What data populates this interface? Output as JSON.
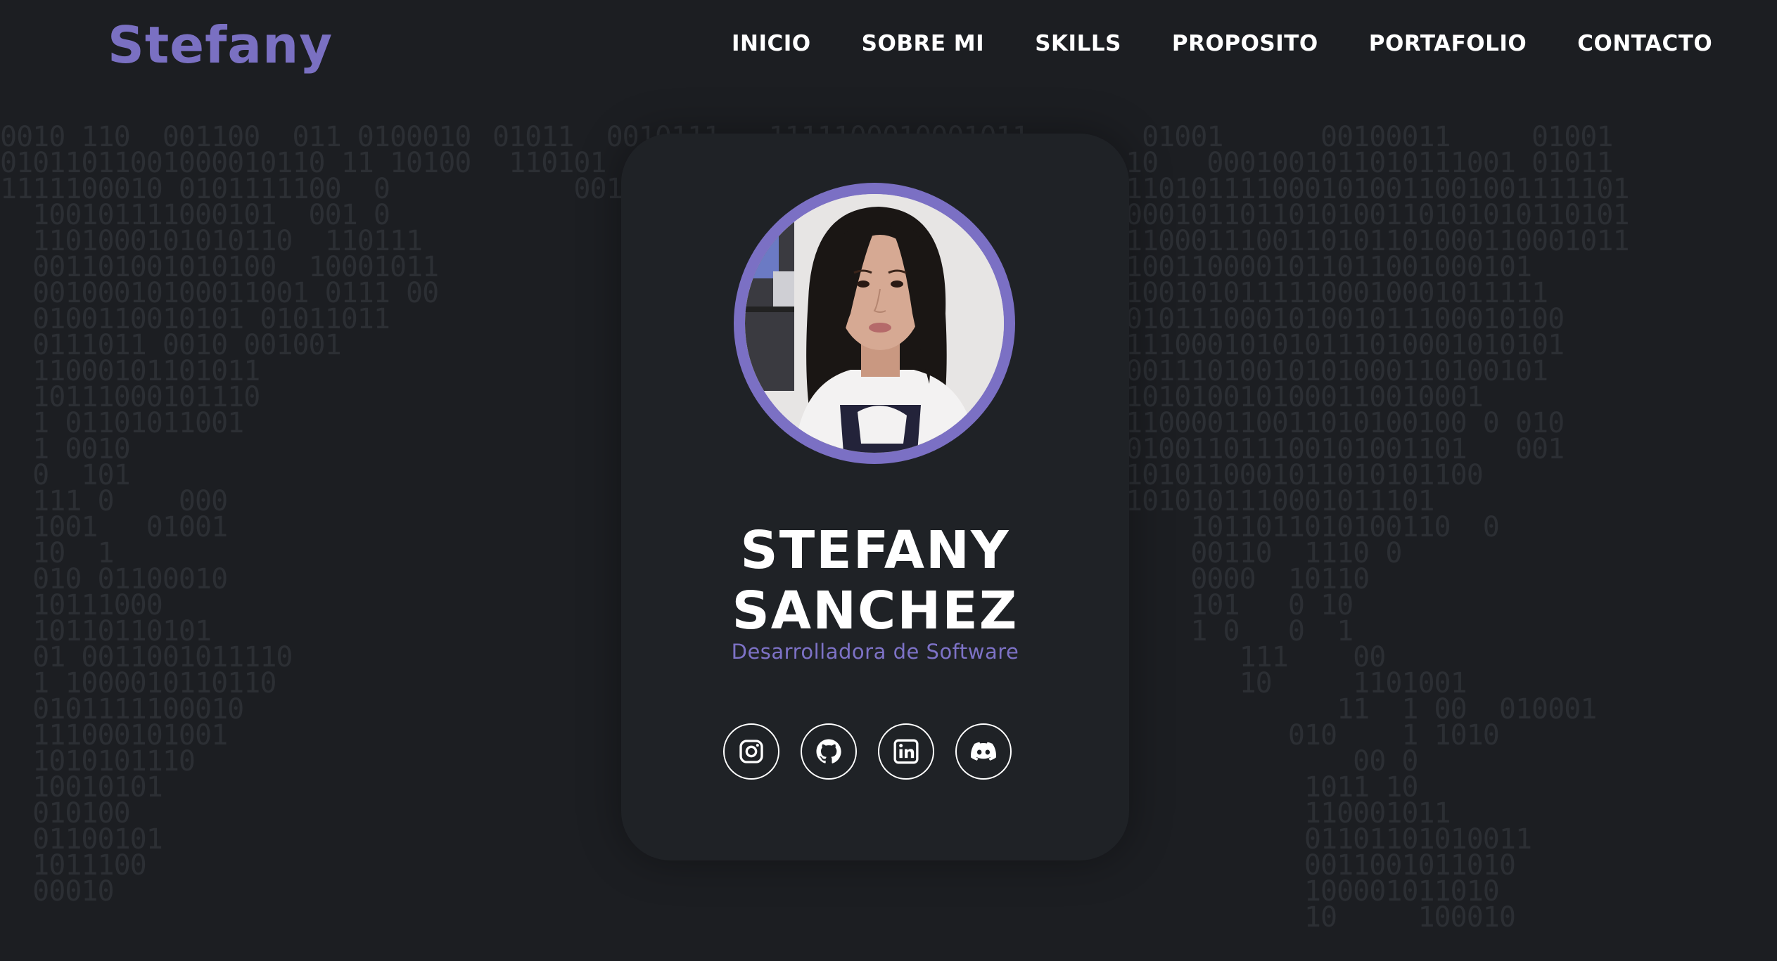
{
  "header": {
    "logo": "Stefany",
    "nav": [
      "INICIO",
      "SOBRE MI",
      "SKILLS",
      "PROPOSITO",
      "PORTAFOLIO",
      "CONTACTO"
    ]
  },
  "profile": {
    "name_line1": "STEFANY",
    "name_line2": "SANCHEZ",
    "role": "Desarrolladora de Software"
  },
  "socials": [
    {
      "icon": "instagram-icon"
    },
    {
      "icon": "github-icon"
    },
    {
      "icon": "linkedin-icon"
    },
    {
      "icon": "discord-icon"
    }
  ],
  "colors": {
    "accent": "#7a70c2",
    "background": "#1c1e22",
    "card": "#1f2226",
    "text": "#ffffff"
  }
}
